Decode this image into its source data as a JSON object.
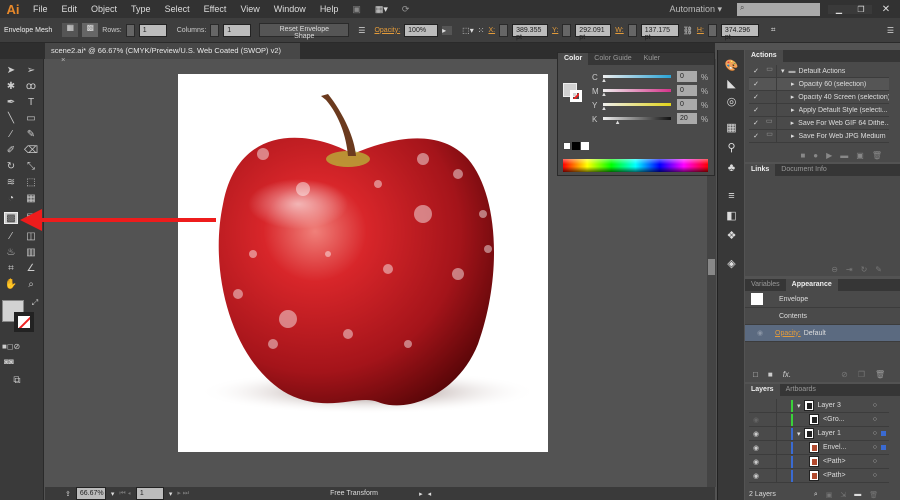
{
  "app": {
    "logo": "Ai",
    "menu": [
      "File",
      "Edit",
      "Object",
      "Type",
      "Select",
      "Effect",
      "View",
      "Window",
      "Help"
    ],
    "workspace": "Automation"
  },
  "control": {
    "mode": "Envelope Mesh",
    "rows_label": "Rows:",
    "rows": "1",
    "columns_label": "Columns:",
    "columns": "1",
    "reset_button": "Reset Envelope Shape",
    "opacity_label": "Opacity:",
    "opacity": "100%",
    "x_label": "X:",
    "x": "389.355 pt",
    "y_label": "Y:",
    "y": "292.091 pt",
    "w_label": "W:",
    "w": "137.175 pt",
    "h_label": "H:",
    "h": "374.296 pt"
  },
  "document": {
    "tab_title": "scene2.ai* @ 66.67% (CMYK/Preview/U.S. Web Coated (SWOP) v2)",
    "close": "×"
  },
  "status": {
    "zoom": "66.67%",
    "page": "1",
    "tool": "Free Transform"
  },
  "color_panel": {
    "tabs": [
      "Color",
      "Color Guide",
      "Kuler"
    ],
    "channels": [
      {
        "label": "C",
        "value": "0",
        "color": "#29a3d6"
      },
      {
        "label": "M",
        "value": "0",
        "color": "#d6338a"
      },
      {
        "label": "Y",
        "value": "0",
        "color": "#e2d419"
      },
      {
        "label": "K",
        "value": "20",
        "color": "#111111"
      }
    ],
    "percent": "%"
  },
  "actions_panel": {
    "tab": "Actions",
    "items": [
      {
        "label": "Default Actions",
        "folder": true
      },
      {
        "label": "Opacity 60 (selection)"
      },
      {
        "label": "Opacity 40 Screen (selection)"
      },
      {
        "label": "Apply Default Style (selecti..."
      },
      {
        "label": "Save For Web GIF 64 Dithe..."
      },
      {
        "label": "Save For Web JPG Medium"
      }
    ]
  },
  "links_panel": {
    "tabs": [
      "Links",
      "Document Info"
    ]
  },
  "appearance_panel": {
    "tabs": [
      "Variables",
      "Appearance"
    ],
    "object": "Envelope",
    "contents": "Contents",
    "opacity_label": "Opacity:",
    "opacity_value": "Default",
    "fx": "fx."
  },
  "layers_panel": {
    "tabs": [
      "Layers",
      "Artboards"
    ],
    "items": [
      {
        "name": "Layer 3",
        "color": "#3ad13a",
        "level": 0
      },
      {
        "name": "<Gro...",
        "color": "#3ad13a",
        "level": 1
      },
      {
        "name": "Layer 1",
        "color": "#3a6ad1",
        "level": 0
      },
      {
        "name": "Envel...",
        "color": "#3a6ad1",
        "level": 1
      },
      {
        "name": "<Path>",
        "color": "#3a6ad1",
        "level": 1
      },
      {
        "name": "<Path>",
        "color": "#3a6ad1",
        "level": 1
      }
    ],
    "count": "2 Layers"
  },
  "accent": {
    "arrow": "#ee1c1c"
  }
}
